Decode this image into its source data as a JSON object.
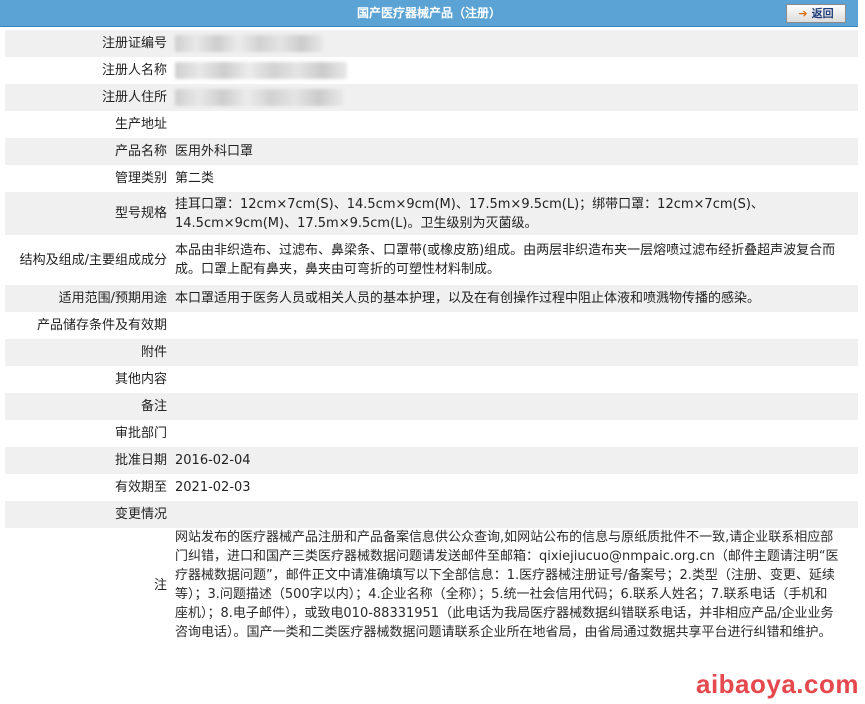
{
  "header": {
    "title": "国产医疗器械产品（注册）",
    "back_label": "返回"
  },
  "fields": [
    {
      "label": "注册证编号",
      "value": "",
      "redacted": true
    },
    {
      "label": "注册人名称",
      "value": "",
      "redacted": true
    },
    {
      "label": "注册人住所",
      "value": "",
      "redacted": true
    },
    {
      "label": "生产地址",
      "value": ""
    },
    {
      "label": "产品名称",
      "value": "医用外科口罩"
    },
    {
      "label": "管理类别",
      "value": "第二类"
    },
    {
      "label": "型号规格",
      "value": "挂耳口罩：12cm×7cm(S)、14.5cm×9cm(M)、17.5m×9.5cm(L)；绑带口罩：12cm×7cm(S)、14.5cm×9cm(M)、17.5m×9.5cm(L)。卫生级别为灭菌级。"
    },
    {
      "label": "结构及组成/主要组成成分",
      "value": "本品由非织造布、过滤布、鼻梁条、口罩带(或橡皮筋)组成。由两层非织造布夹一层熔喷过滤布经折叠超声波复合而成。口罩上配有鼻夹，鼻夹由可弯折的可塑性材料制成。"
    },
    {
      "label": "适用范围/预期用途",
      "value": "本口罩适用于医务人员或相关人员的基本护理，以及在有创操作过程中阻止体液和喷溅物传播的感染。"
    },
    {
      "label": "产品储存条件及有效期",
      "value": ""
    },
    {
      "label": "附件",
      "value": ""
    },
    {
      "label": "其他内容",
      "value": ""
    },
    {
      "label": "备注",
      "value": ""
    },
    {
      "label": "审批部门",
      "value": ""
    },
    {
      "label": "批准日期",
      "value": "2016-02-04"
    },
    {
      "label": "有效期至",
      "value": "2021-02-03"
    },
    {
      "label": "变更情况",
      "value": ""
    }
  ],
  "note": {
    "label": "注",
    "text": "网站发布的医疗器械产品注册和产品备案信息供公众查询,如网站公布的信息与原纸质批件不一致,请企业联系相应部门纠错，进口和国产三类医疗器械数据问题请发送邮件至邮箱：qixiejiucuo@nmpaic.org.cn（邮件主题请注明“医疗器械数据问题”，邮件正文中请准确填写以下全部信息：1.医疗器械注册证号/备案号；2.类型（注册、变更、延续等）；3.问题描述（500字以内）；4.企业名称（全称）；5.统一社会信用代码；6.联系人姓名；7.联系电话（手机和座机）；8.电子邮件），或致电010-88331951（此电话为我局医疗器械数据纠错联系电话，并非相应产品/企业业务咨询电话）。国产一类和二类医疗器械数据问题请联系企业所在地省局，由省局通过数据共享平台进行纠错和维护。"
  },
  "watermark": "aibaoya.com"
}
